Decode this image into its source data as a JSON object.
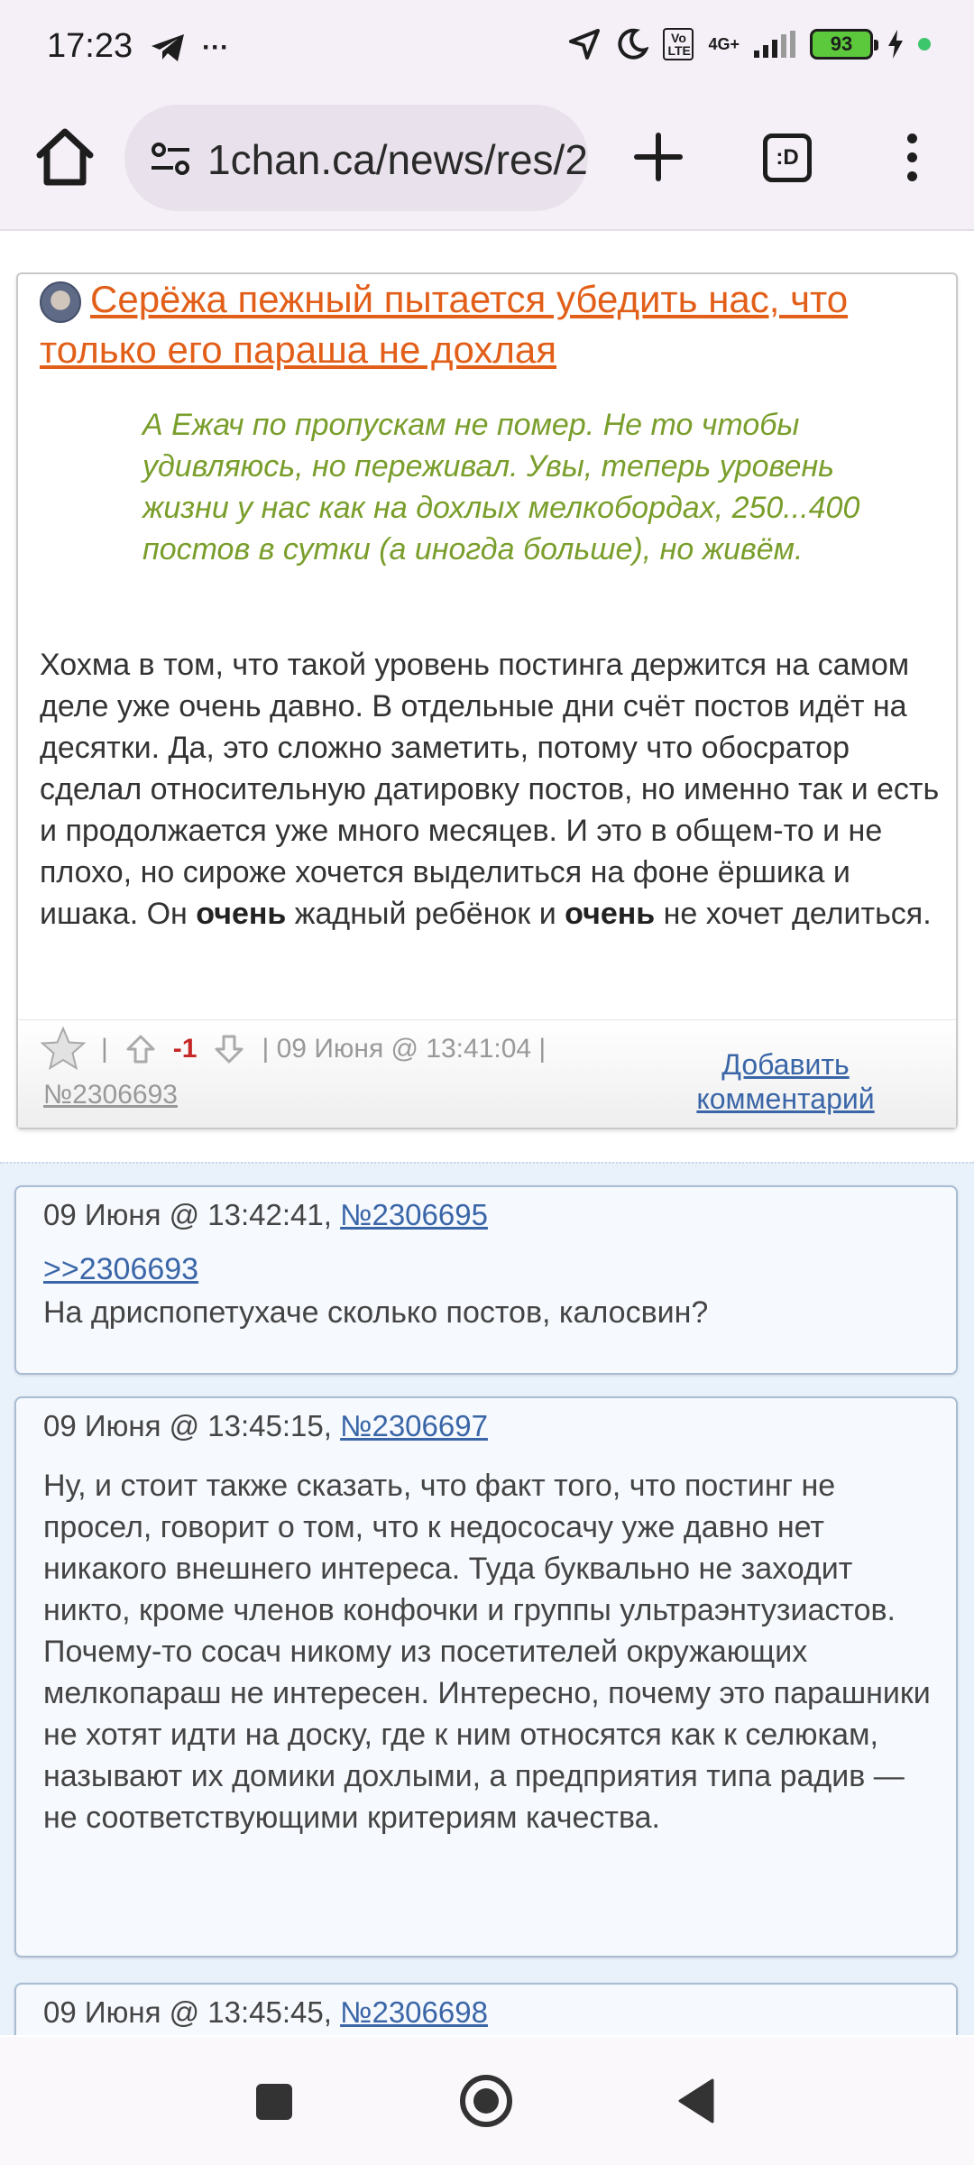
{
  "status_bar": {
    "time": "17:23",
    "extra_icons": "···",
    "network_badge": "Vo LTE",
    "network_type": "4G+",
    "battery": "93"
  },
  "browser": {
    "url": "1chan.ca/news/res/2",
    "tabs_label": ":D"
  },
  "op": {
    "title": "Серёжа пежный пытается убедить нас, что только его параша не дохлая",
    "quote": "А Ежач по пропускам не помер. Не то чтобы удивляюсь, но переживал. Увы, теперь уровень жизни у нас как на дохлых мелкобордах, 250...400 постов в сутки (а иногда больше), но живём.",
    "body_part1": "Хохма в том, что такой уровень постинга держится на самом деле уже очень давно. В отдельные дни счёт постов идёт на десятки. Да, это сложно заметить, потому что обосратор сделал относительную датировку постов, но именно так и есть и продолжается уже много месяцев. И это в общем-то и не плохо, но сироже хочется выделиться на фоне ёршика и ишака. Он ",
    "body_bold1": "очень",
    "body_part2": " жадный ребёнок и ",
    "body_bold2": "очень",
    "body_part3": " не хочет делиться.",
    "separator": "|",
    "score": "-1",
    "datetime": "| 09 Июня @ 13:41:04 |",
    "post_number": "№2306693",
    "add_comment": "Добавить комментарий"
  },
  "comments": [
    {
      "date": "09 Июня @ 13:42:41,",
      "number": "№2306695",
      "reply_ref": ">>2306693",
      "text": "На дриспопетухаче сколько постов, калосвин?"
    },
    {
      "date": "09 Июня @ 13:45:15,",
      "number": "№2306697",
      "text": "Ну, и стоит также сказать, что факт того, что постинг не просел, говорит о том, что к недососачу уже давно нет никакого внешнего интереса. Туда буквально не заходит никто, кроме членов конфочки и группы ультраэнтузиастов. Почему-то сосач никому из посетителей окружающих мелкопараш не интересен. Интересно, почему это парашники не хотят идти на доску, где к ним относятся как к селюкам, называют их домики дохлыми, а предприятия типа радив — не соответствующими критериям качества."
    },
    {
      "date": "09 Июня @ 13:45:45,",
      "number": "№2306698"
    }
  ]
}
